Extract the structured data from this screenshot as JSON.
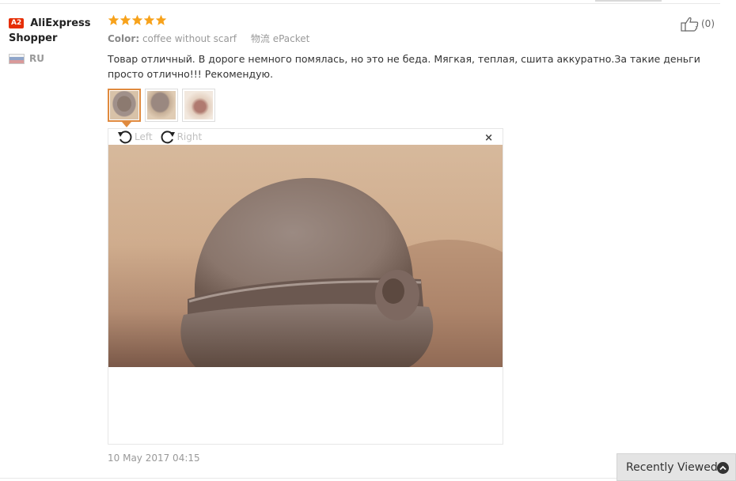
{
  "buyer": {
    "level": "A2",
    "name_line1": "AliExpress",
    "name_line2": "Shopper",
    "country": "RU"
  },
  "review": {
    "rating": 5,
    "color_label": "Color:",
    "color_value": "coffee without scarf",
    "shipping_label": "物流",
    "shipping_value": "ePacket",
    "text": "Товар отличный. В дороге немного помялась, но это не беда. Мягкая, теплая, сшита аккуратно.За такие деньги просто отлично!!! Рекомендую.",
    "date": "10 May 2017 04:15"
  },
  "helpful": {
    "count": "(0)"
  },
  "viewer": {
    "rotate_left": "Left",
    "rotate_right": "Right",
    "close": "×"
  },
  "icons": {
    "star": "star-icon",
    "like": "thumbs-up-icon",
    "rotate_left": "rotate-left-icon",
    "rotate_right": "rotate-right-icon",
    "close": "close-icon",
    "up": "chevron-up-icon"
  },
  "colors": {
    "star": "#f7a21b",
    "badge": "#e62e04",
    "active_border": "#e08a3e"
  },
  "recently_viewed": {
    "label": "Recently Viewed"
  }
}
